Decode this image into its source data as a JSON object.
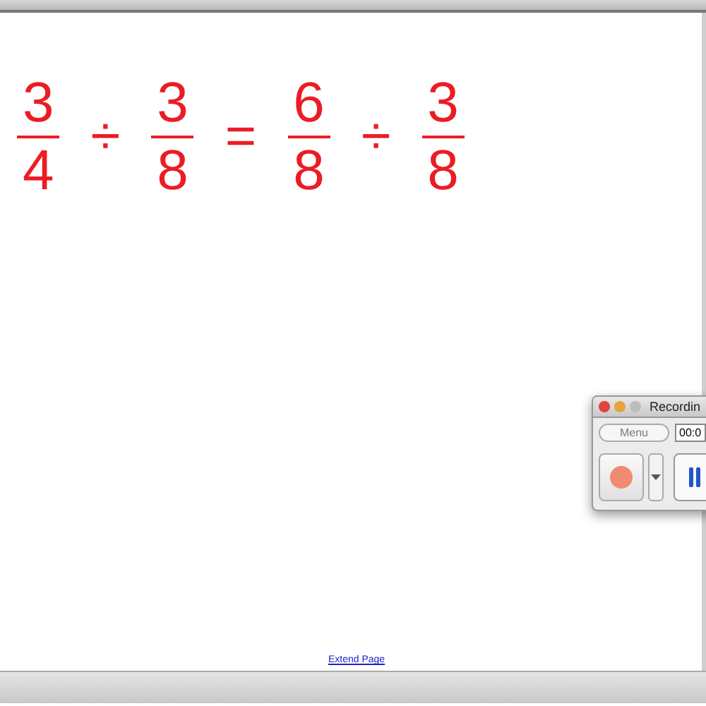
{
  "equation": [
    {
      "kind": "fraction",
      "numerator": "3",
      "denominator": "4"
    },
    {
      "kind": "operator",
      "symbol": "÷"
    },
    {
      "kind": "fraction",
      "numerator": "3",
      "denominator": "8"
    },
    {
      "kind": "operator",
      "symbol": "="
    },
    {
      "kind": "fraction",
      "numerator": "6",
      "denominator": "8"
    },
    {
      "kind": "operator",
      "symbol": "÷"
    },
    {
      "kind": "fraction",
      "numerator": "3",
      "denominator": "8"
    }
  ],
  "recorder": {
    "title": "Recordin",
    "menu_button": "Menu",
    "time": "00:0"
  },
  "footer": {
    "link": "Extend Page"
  }
}
